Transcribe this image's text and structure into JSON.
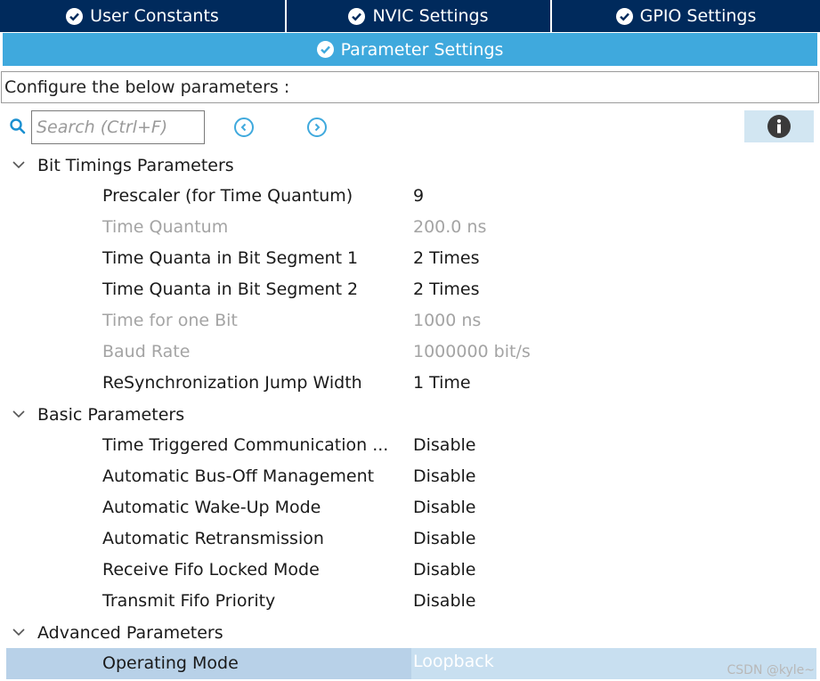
{
  "tabs": [
    {
      "label": "User Constants",
      "icon": "check-circle-icon"
    },
    {
      "label": "NVIC Settings",
      "icon": "check-circle-icon"
    },
    {
      "label": "GPIO Settings",
      "icon": "check-circle-icon"
    }
  ],
  "active_tab": {
    "label": "Parameter Settings",
    "icon": "check-circle-icon"
  },
  "configure_text": "Configure the below parameters :",
  "search": {
    "placeholder": "Search (Ctrl+F)"
  },
  "colors": {
    "tab_bg": "#002a5c",
    "active_tab_bg": "#3fa9dd",
    "selected_row": "#b8d1e8"
  },
  "groups": {
    "bit_timings": {
      "label": "Bit Timings Parameters",
      "params": [
        {
          "name": "Prescaler (for Time Quantum)",
          "value": "9"
        },
        {
          "name": "Time Quantum",
          "value": "200.0 ns"
        },
        {
          "name": "Time Quanta in Bit Segment 1",
          "value": "2 Times"
        },
        {
          "name": "Time Quanta in Bit Segment 2",
          "value": "2 Times"
        },
        {
          "name": "Time for one Bit",
          "value": "1000 ns"
        },
        {
          "name": "Baud Rate",
          "value": "1000000 bit/s"
        },
        {
          "name": "ReSynchronization Jump Width",
          "value": "1 Time"
        }
      ]
    },
    "basic": {
      "label": "Basic Parameters",
      "params": [
        {
          "name": "Time Triggered Communication ...",
          "value": "Disable"
        },
        {
          "name": "Automatic Bus-Off Management",
          "value": "Disable"
        },
        {
          "name": "Automatic Wake-Up Mode",
          "value": "Disable"
        },
        {
          "name": "Automatic Retransmission",
          "value": "Disable"
        },
        {
          "name": "Receive Fifo Locked Mode",
          "value": "Disable"
        },
        {
          "name": "Transmit Fifo Priority",
          "value": "Disable"
        }
      ]
    },
    "advanced": {
      "label": "Advanced Parameters",
      "params": [
        {
          "name": "Operating Mode",
          "value": "Loopback"
        }
      ]
    }
  },
  "watermark": "CSDN @kyle~"
}
